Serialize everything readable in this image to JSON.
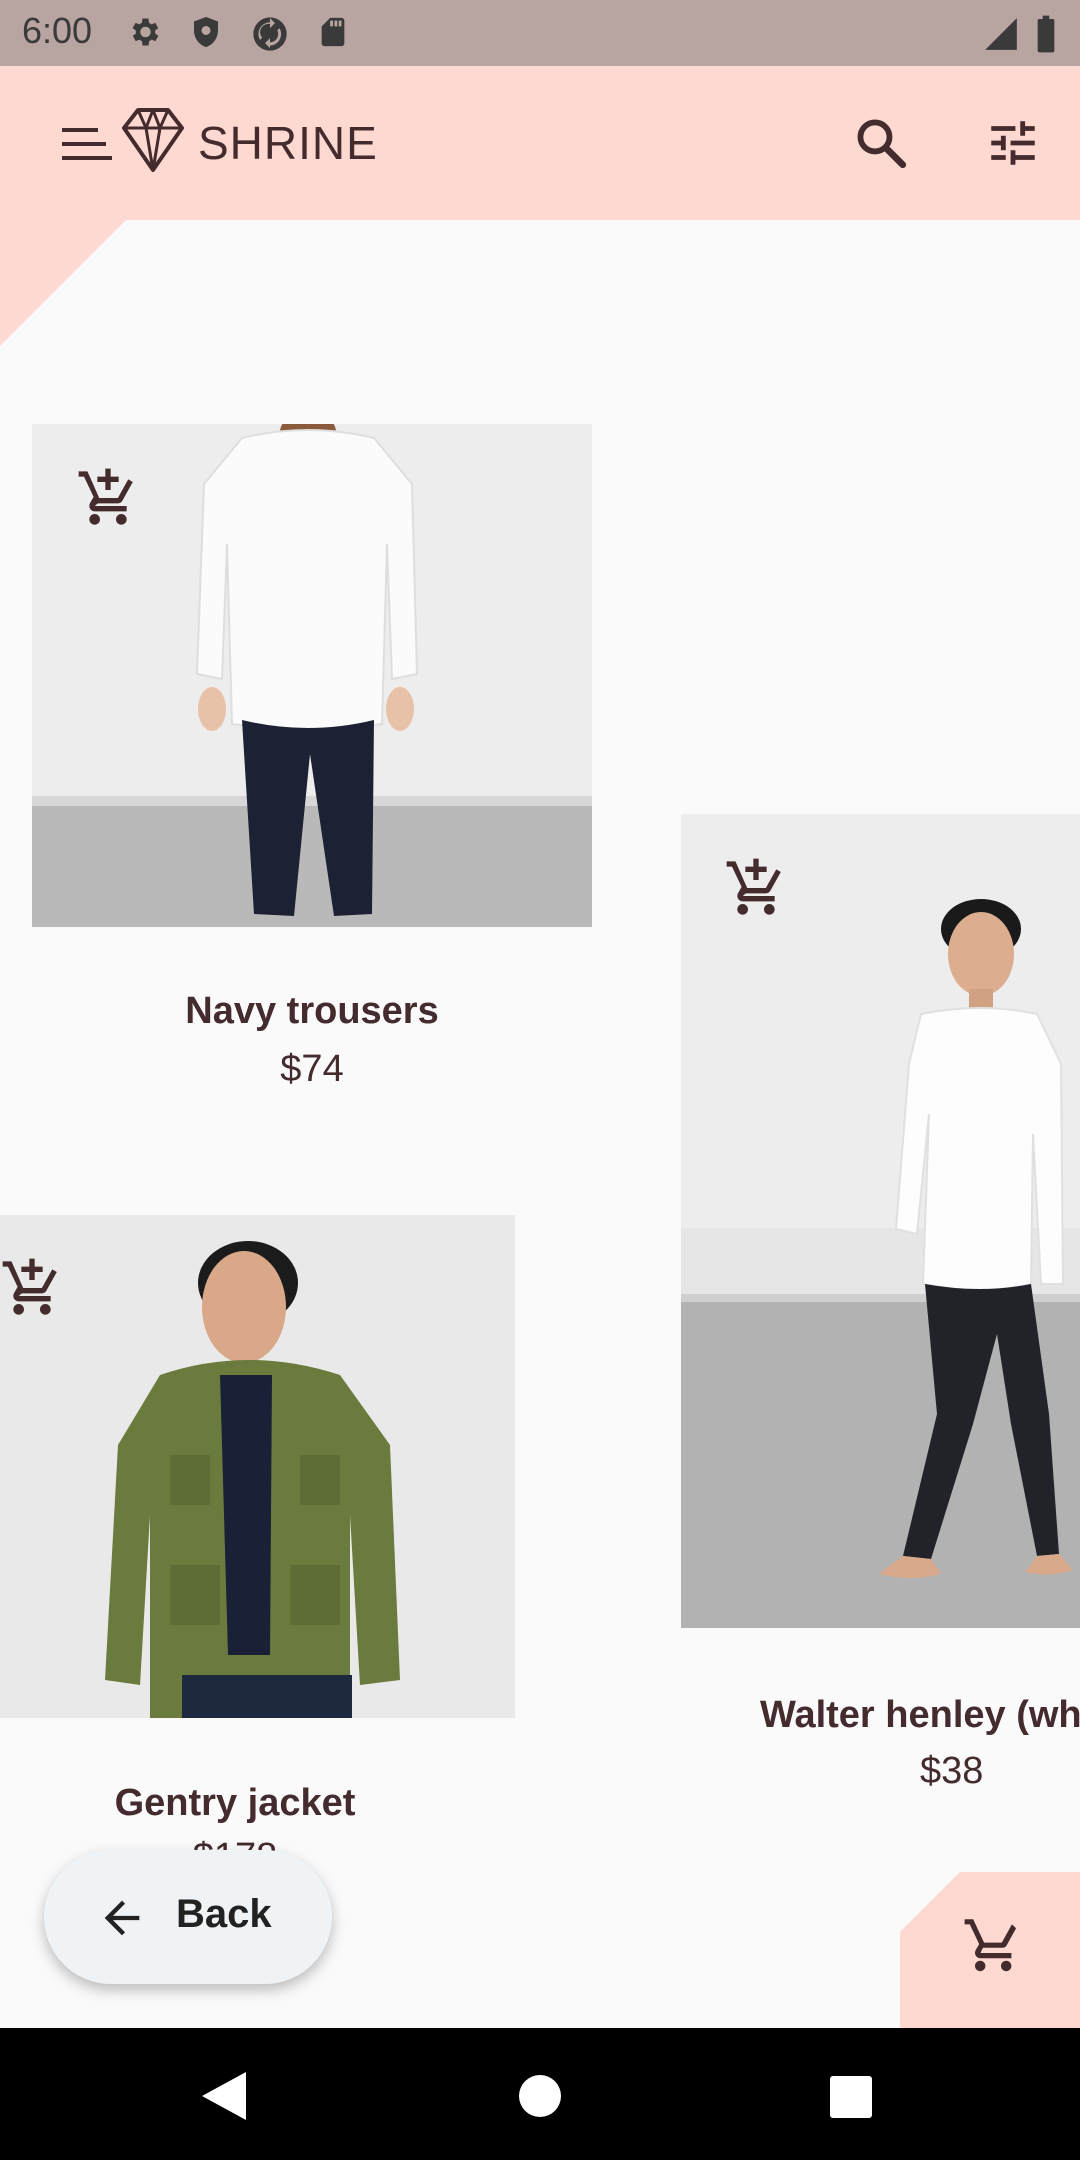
{
  "status_bar": {
    "time": "6:00",
    "icons_left": [
      "settings-icon",
      "shield-icon",
      "sync-icon",
      "sd-card-icon"
    ],
    "icons_right": [
      "signal-icon",
      "battery-icon"
    ]
  },
  "app_bar": {
    "brand": "SHRINE",
    "menu_icon": "menu-icon",
    "logo_icon": "diamond-icon",
    "actions": [
      "search-icon",
      "tune-icon"
    ]
  },
  "products": [
    {
      "name": "Navy trousers",
      "price": "$74"
    },
    {
      "name": "Walter henley (wh",
      "price": "$38"
    },
    {
      "name": "Gentry jacket",
      "price": "$178"
    }
  ],
  "back_button": {
    "label": "Back"
  },
  "colors": {
    "app_bar": "#fed9d1",
    "text": "#442b2d",
    "background": "#fafafa"
  }
}
